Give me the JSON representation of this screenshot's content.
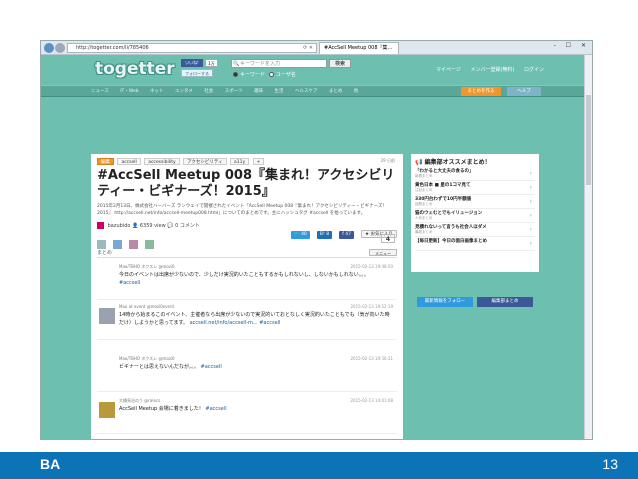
{
  "browser": {
    "url": "http://togetter.com/li/785406",
    "tab_title": "#AccSell Meetup 008『集…",
    "window_controls": "- ☐ ✕"
  },
  "header": {
    "logo": "togetter",
    "fb_like": "いいね!",
    "fb_count": "1万",
    "tw_follow": "フォローする",
    "search_placeholder": "キーワードを入力",
    "search_button": "検索",
    "radio_keyword": "キーワード",
    "radio_user": "ユーザ名",
    "links": [
      "マイページ",
      "メンバー登録(無料)",
      "ログイン"
    ]
  },
  "catnav": {
    "items": [
      "ニュース",
      "IT・Web",
      "ネット",
      "エンタメ",
      "社会",
      "スポーツ",
      "趣味",
      "生活",
      "ヘルスケア",
      "まとめ",
      "他"
    ],
    "matome_button": "まとめを作る",
    "help_button": "ヘルプ"
  },
  "article": {
    "tags": [
      "編集",
      "accsell",
      "accessibility",
      "アクセシビリティ",
      "a11y",
      "+"
    ],
    "posted": "29 日前",
    "title": "#AccSell Meetup 008『集まれ！アクセシビリティー・ビギナーズ！2015』",
    "description": "2015年2月13日、株式会社ハーバーズ ランウェイで開催されたイベント『AccSell Meetup 008『集まれ！アクセシビリティー・ビギナーズ！2015』 http://accsell.net/info/accsell-meetup008.html」についてのまとめです。主にハッシュタグ #accsell を拾っています。",
    "author": "bazubido",
    "views": "6359",
    "view_label": "view",
    "comments": "0",
    "comment_label": "コメント",
    "share_tw": "40",
    "share_hb": "8",
    "share_fb": "47",
    "fav": "お気に入り",
    "count": "4",
    "section_title": "まとめ",
    "menu_button": "メニュー"
  },
  "tweets": [
    {
      "name": "Mao/TBHO ネクスレ @mozi0",
      "time": "2015-02-13 19:48:50",
      "text": "今日のイベントは出席が少ないので、少しだけ実況的いたこともするかもしれないし、しないかもしれない。。。",
      "tag": "#accsell"
    },
    {
      "name": "Mao at event @mozi0event",
      "time": "2015-02-13 19:52:19",
      "text": "14時から始まるこのイベント、主催者なら出席が少ないので実況的いておとなしく実況的いたこともでも（気が向いた時だけ）しようかと思ってます。",
      "link": "accsell.net/info/accsell-m...",
      "tag": "#accsell"
    },
    {
      "name": "Mao/TBHO ネクスレ @mozi0",
      "time": "2015-02-13 19:56:31",
      "text": "ビギナーとは思えないんだなが。。。",
      "tag": "#accsell"
    },
    {
      "name": "大橋亮治のう @ralecs",
      "time": "2015-02-13 14:01:08",
      "text": "AccSell Meetup 会場に着きました！",
      "tag": "#accsell"
    }
  ],
  "sidebar": {
    "heading": "編集部オススメまとめ！",
    "items": [
      {
        "title": "「わかると大丈夫の食るの」",
        "sub": "新着まとめ"
      },
      {
        "title": "黄色日本 ■ 星の1コマ見て",
        "sub": "注目まとめ"
      },
      {
        "title": "330円台わずで10円半額値",
        "sub": "話題まとめ"
      },
      {
        "title": "猫のウェむとでもイリュージョン",
        "sub": "人気まとめ"
      },
      {
        "title": "見積れないって言うも社会人ほダメ",
        "sub": "最新まとめ"
      },
      {
        "title": "【毎日更新】今日の面白画像まとめ",
        "sub": ""
      }
    ],
    "tw_button": "最新情報をフォロー",
    "fb_button": "編集部まとめ"
  },
  "footer": {
    "left": "BA",
    "right": "13"
  }
}
